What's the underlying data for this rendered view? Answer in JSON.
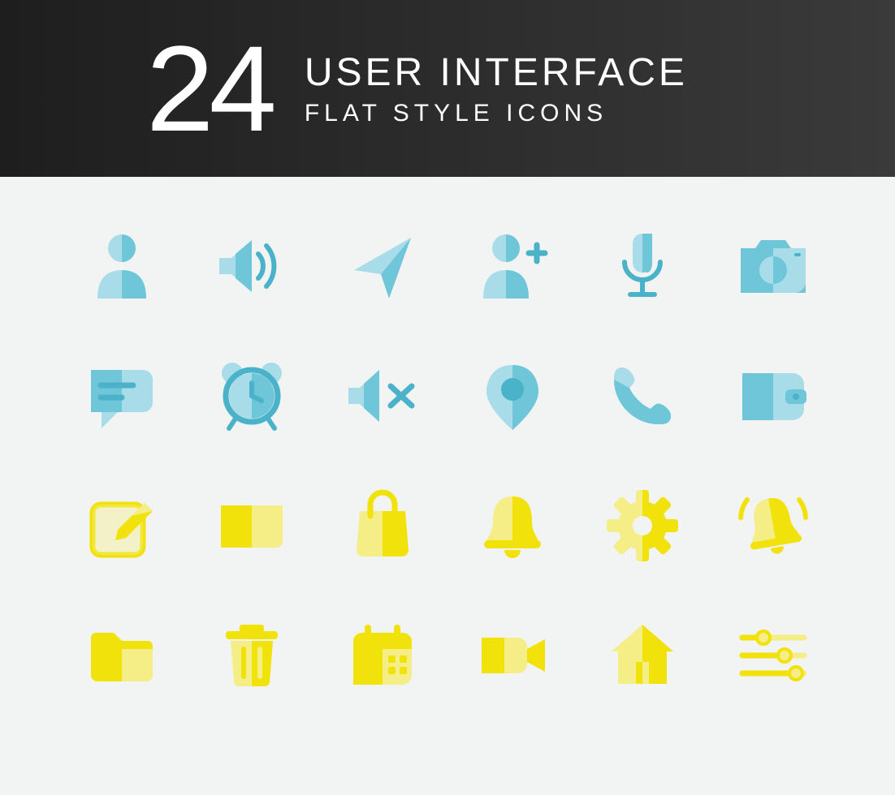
{
  "header": {
    "count": "24",
    "line1": "USER INTERFACE",
    "line2": "FLAT STYLE ICONS"
  },
  "colors": {
    "blue_dark": "#6fc6d9",
    "blue_light": "#a8dce8",
    "blue_stroke": "#4ab3c9",
    "yellow_dark": "#f2e20c",
    "yellow_light": "#f5ed85"
  },
  "icons": [
    {
      "name": "user-icon"
    },
    {
      "name": "volume-icon"
    },
    {
      "name": "send-icon"
    },
    {
      "name": "add-user-icon"
    },
    {
      "name": "microphone-icon"
    },
    {
      "name": "camera-icon"
    },
    {
      "name": "chat-icon"
    },
    {
      "name": "alarm-clock-icon"
    },
    {
      "name": "mute-icon"
    },
    {
      "name": "location-pin-icon"
    },
    {
      "name": "phone-icon"
    },
    {
      "name": "wallet-icon"
    },
    {
      "name": "edit-icon"
    },
    {
      "name": "mail-icon"
    },
    {
      "name": "shopping-bag-icon"
    },
    {
      "name": "bell-icon"
    },
    {
      "name": "gear-icon"
    },
    {
      "name": "bell-ringing-icon"
    },
    {
      "name": "folder-icon"
    },
    {
      "name": "trash-icon"
    },
    {
      "name": "calendar-icon"
    },
    {
      "name": "video-camera-icon"
    },
    {
      "name": "home-icon"
    },
    {
      "name": "sliders-icon"
    }
  ]
}
